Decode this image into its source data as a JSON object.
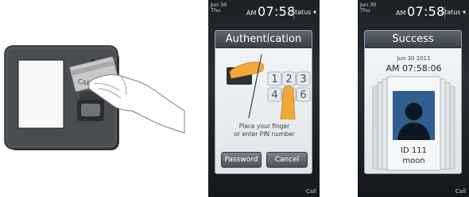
{
  "illustration": {
    "card_text": "CARD"
  },
  "screen_auth": {
    "statusbar": {
      "month_day": "Jun  30",
      "weekday": "Thu",
      "ampm": "AM",
      "time": "07:58",
      "status_label": "Status ▾"
    },
    "title": "Authentication",
    "keypad_digits": [
      "1",
      "2",
      "3",
      "4",
      "5",
      "6"
    ],
    "prompt_line1": "Place your finger",
    "prompt_line2": "or enter PIN number",
    "password_button": "Password",
    "cancel_button": "Cancel",
    "call_label": "Call"
  },
  "screen_success": {
    "statusbar": {
      "month_day": "Jun  30",
      "weekday": "Thu",
      "ampm": "AM",
      "time": "07:58",
      "status_label": "Status ▾"
    },
    "title": "Success",
    "date": "Jun 30 2011",
    "time": "AM  07:58:06",
    "user_id": "ID  111",
    "user_name": "moon",
    "call_label": "Call"
  },
  "colors": {
    "phone_bg": "#1d2126",
    "panel_bg": "#eef1f4",
    "header_bg": "#4a525b",
    "finger": "#f2a93a",
    "avatar_bg": "#2f5f8f"
  }
}
